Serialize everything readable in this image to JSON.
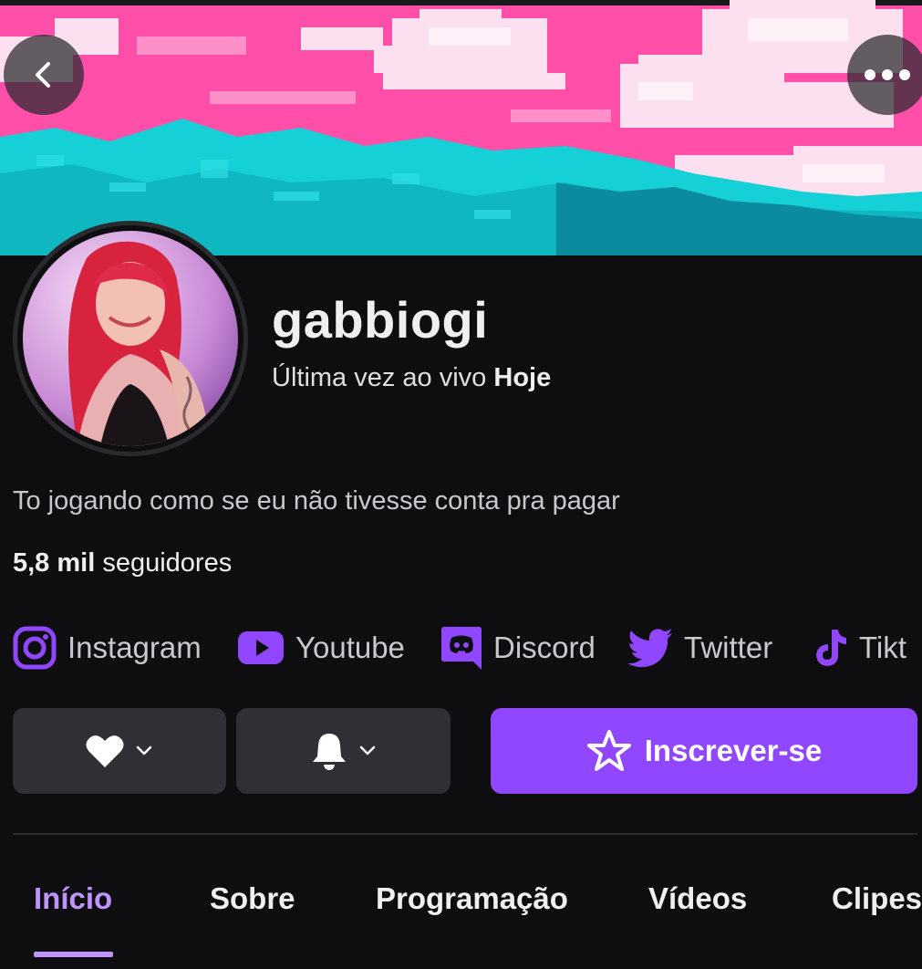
{
  "channel": {
    "username": "gabbiogi",
    "last_live_prefix": "Última vez ao vivo",
    "last_live_value": "Hoje",
    "bio": "To jogando como se eu não tivesse conta pra pagar",
    "followers_count": "5,8 mil",
    "followers_label": "seguidores"
  },
  "socials": [
    {
      "label": "Instagram",
      "icon": "instagram-icon"
    },
    {
      "label": "Youtube",
      "icon": "youtube-icon"
    },
    {
      "label": "Discord",
      "icon": "discord-icon"
    },
    {
      "label": "Twitter",
      "icon": "twitter-icon"
    },
    {
      "label": "Tikt",
      "icon": "tiktok-icon"
    }
  ],
  "actions": {
    "subscribe_label": "Inscrever-se"
  },
  "tabs": [
    {
      "label": "Início",
      "active": true
    },
    {
      "label": "Sobre"
    },
    {
      "label": "Programação"
    },
    {
      "label": "Vídeos"
    },
    {
      "label": "Clipes"
    }
  ],
  "colors": {
    "accent": "#9147ff",
    "accent_light": "#bf94ff",
    "background": "#0e0e10",
    "button_dark": "#2f2f35",
    "banner_pink": "#ff4fa8",
    "banner_cyan": "#15d0d6"
  }
}
